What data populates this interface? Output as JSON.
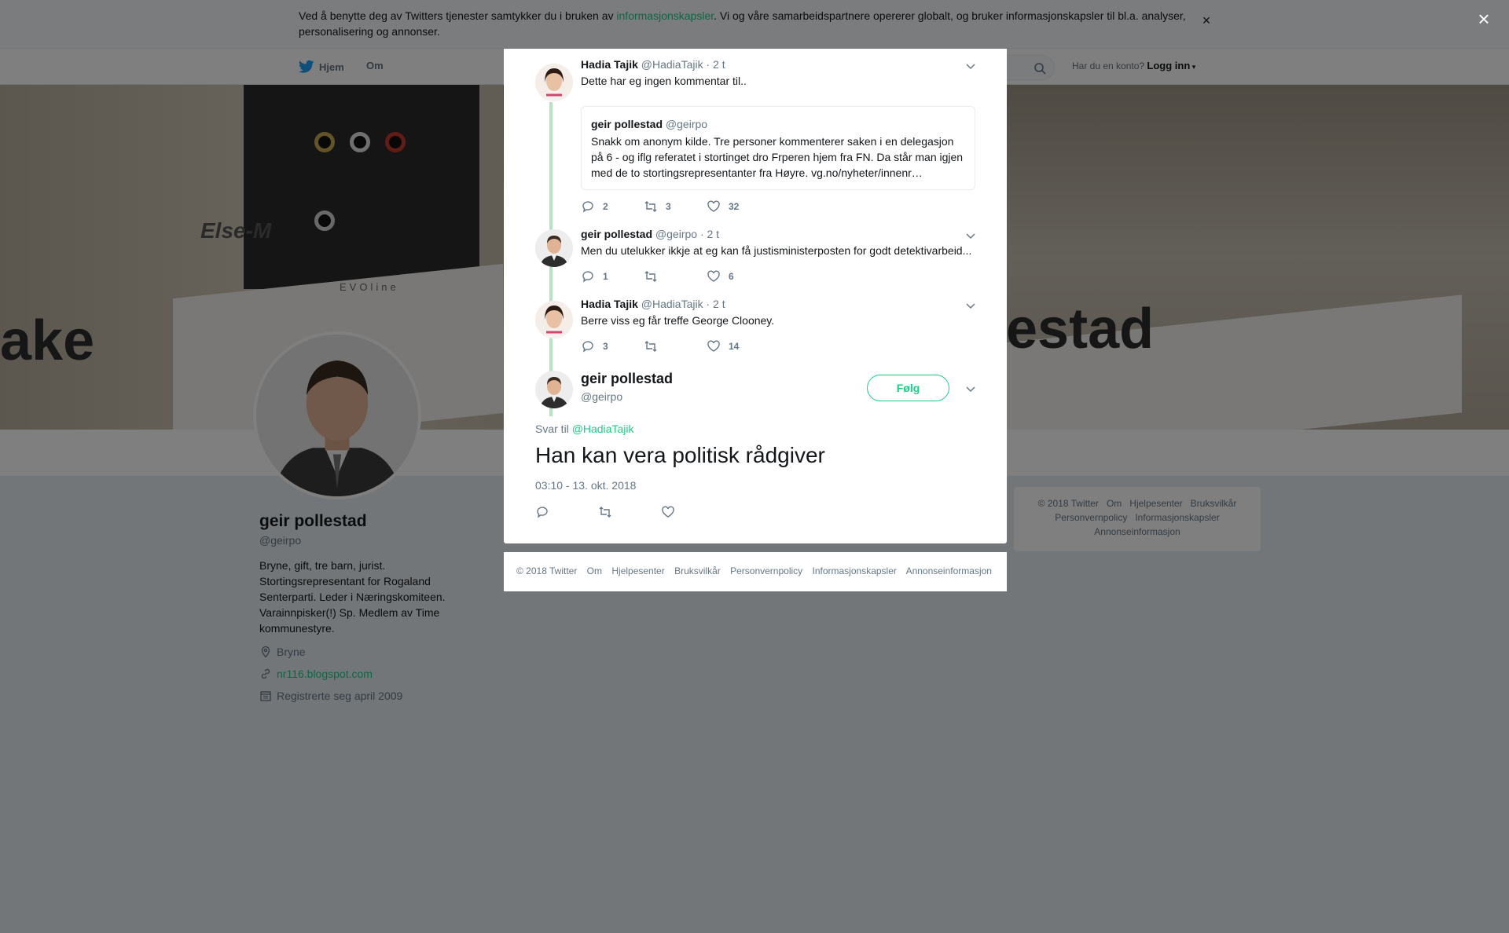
{
  "cookie_banner": {
    "text_before": "Ved å benytte deg av Twitters tjenester samtykker du i bruken av ",
    "link": "informasjonskapsler",
    "text_after": ". Vi og våre samarbeidspartnere opererer globalt, og bruker informasjonskapsler til bl.a. analyser, personalisering og annonser.",
    "close": "×"
  },
  "nav": {
    "home": "Hjem",
    "about": "Om",
    "login_prompt": "Har du en konto?",
    "login": "Logg inn"
  },
  "profile": {
    "name": "geir pollestad",
    "handle": "@geirpo",
    "bio": "Bryne, gift, tre barn, jurist. Stortingsrepresentant for Rogaland Senterparti. Leder i Næringskomiteen. Varainnpisker(!) Sp. Medlem av Time kommunestyre.",
    "location": "Bryne",
    "website": "nr116.blogspot.com",
    "joined": "Registrerte seg april 2009"
  },
  "banner": {
    "text_left": "Else-M",
    "text_mid": "EVOline",
    "text_nametag_left": "ake",
    "text_nametag_right": "estad"
  },
  "side_footer": {
    "links": [
      "© 2018 Twitter",
      "Om",
      "Hjelpesenter",
      "Bruksvilkår",
      "Personvernpolicy",
      "Informasjonskapsler",
      "Annonseinformasjon"
    ]
  },
  "overlay_close": "×",
  "thread": [
    {
      "name": "Hadia Tajik",
      "handle": "@HadiaTajik",
      "time": "· 2 t",
      "text": "Dette har eg ingen kommentar til..",
      "quote": {
        "name": "geir pollestad",
        "handle": "@geirpo",
        "text": "Snakk om anonym kilde. Tre personer kommenterer saken i en delegasjon på 6 - og iflg referatet i stortinget dro Frperen hjem fra FN. Da står man igjen med de to stortingsrepresentanter fra Høyre. vg.no/nyheter/innenr…"
      },
      "replies": "2",
      "retweets": "3",
      "likes": "32"
    },
    {
      "name": "geir pollestad",
      "handle": "@geirpo",
      "time": "· 2 t",
      "text": "Men du utelukker ikkje at eg kan få justisministerposten for godt detektivarbeid...",
      "replies": "1",
      "retweets": "",
      "likes": "6"
    },
    {
      "name": "Hadia Tajik",
      "handle": "@HadiaTajik",
      "time": "· 2 t",
      "text": "Berre viss eg får treffe George Clooney.",
      "replies": "3",
      "retweets": "",
      "likes": "14"
    }
  ],
  "main_tweet": {
    "name": "geir pollestad",
    "handle": "@geirpo",
    "follow": "Følg",
    "reply_to_label": "Svar til",
    "reply_to_handle": "@HadiaTajik",
    "text": "Han kan vera politisk rådgiver",
    "date": "03:10 - 13. okt. 2018"
  },
  "modal_footer": {
    "links": [
      "© 2018 Twitter",
      "Om",
      "Hjelpesenter",
      "Bruksvilkår",
      "Personvernpolicy",
      "Informasjonskapsler",
      "Annonseinformasjon"
    ]
  },
  "colors": {
    "accent": "#19cf86",
    "thread_line": "#b6e3c1",
    "muted": "#657786",
    "text": "#14171a"
  },
  "icons": [
    "twitter-bird-icon",
    "search-icon",
    "caret-down-icon",
    "location-icon",
    "link-icon",
    "calendar-icon",
    "reply-icon",
    "retweet-icon",
    "like-icon",
    "close-icon"
  ]
}
